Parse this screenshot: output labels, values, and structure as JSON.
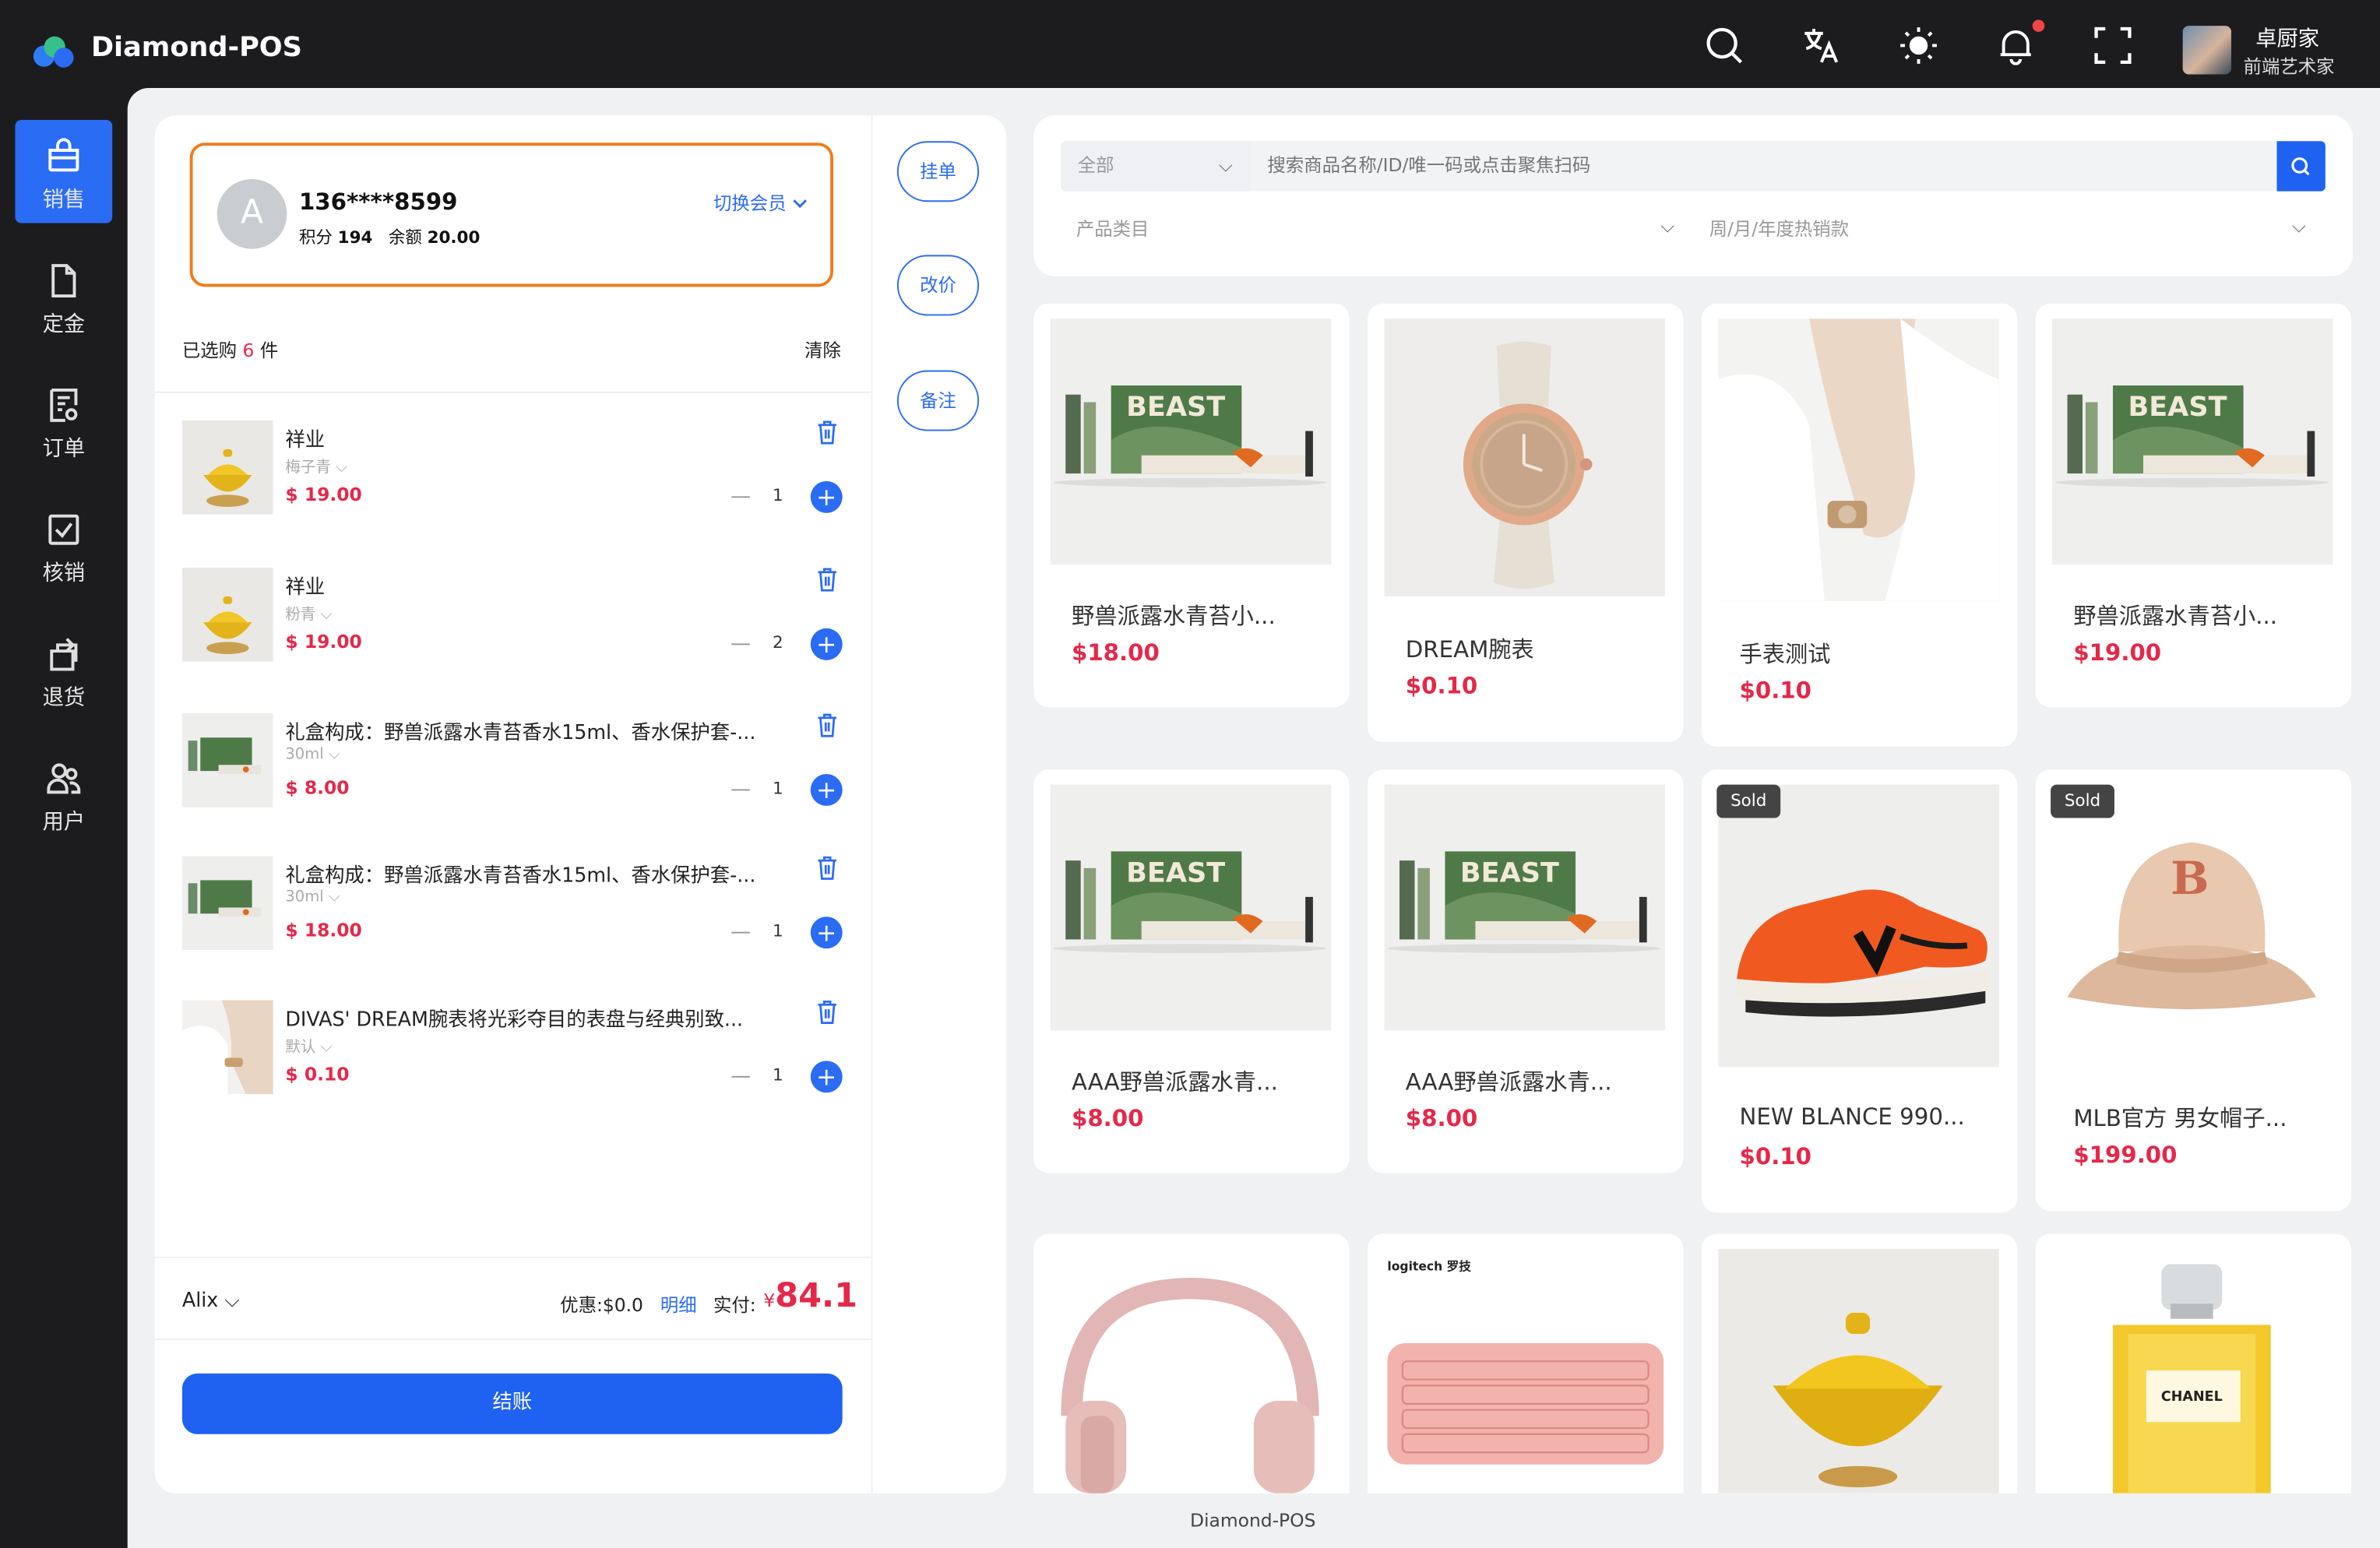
{
  "app": {
    "title": "Diamond-POS",
    "footer": "Diamond-POS"
  },
  "user": {
    "name": "卓厨家",
    "role": "前端艺术家"
  },
  "topbar_icons": [
    "search-icon",
    "translate-icon",
    "theme-sun-icon",
    "bell-icon",
    "fullscreen-icon"
  ],
  "sidebar": {
    "items": [
      {
        "label": "销售",
        "icon": "shop-bag-icon",
        "active": true
      },
      {
        "label": "定金",
        "icon": "document-icon"
      },
      {
        "label": "订单",
        "icon": "order-icon"
      },
      {
        "label": "核销",
        "icon": "checkbox-icon"
      },
      {
        "label": "退货",
        "icon": "return-icon"
      },
      {
        "label": "用户",
        "icon": "users-icon"
      }
    ]
  },
  "member": {
    "avatar_letter": "A",
    "phone": "136****8599",
    "points_label": "积分",
    "points": "194",
    "balance_label": "余额",
    "balance": "20.00",
    "switch_label": "切换会员"
  },
  "cart": {
    "selected_prefix": "已选购",
    "selected_count": "6",
    "selected_suffix": "件",
    "clear_label": "清除",
    "items": [
      {
        "name": "祥业",
        "spec": "梅子青",
        "price": "$ 19.00",
        "qty": "1",
        "thumb": "teacup"
      },
      {
        "name": "祥业",
        "spec": "粉青",
        "price": "$ 19.00",
        "qty": "2",
        "thumb": "teacup"
      },
      {
        "name": "礼盒构成：野兽派露水青苔香水15ml、香水保护套-...",
        "spec": "30ml",
        "price": "$ 8.00",
        "qty": "1",
        "thumb": "beast"
      },
      {
        "name": "礼盒构成：野兽派露水青苔香水15ml、香水保护套-...",
        "spec": "30ml",
        "price": "$ 18.00",
        "qty": "1",
        "thumb": "beast"
      },
      {
        "name": "DIVAS' DREAM腕表将光彩夺目的表盘与经典别致...",
        "spec": "默认",
        "price": "$ 0.10",
        "qty": "1",
        "thumb": "wrist"
      }
    ],
    "staff": "Alix",
    "discount_label": "优惠:$0.0",
    "detail_label": "明细",
    "paid_label": "实付:",
    "currency": "¥",
    "paid_amount": "84.1",
    "checkout_label": "结账"
  },
  "actions": {
    "hold": "挂单",
    "reprice": "改价",
    "note": "备注"
  },
  "search": {
    "category": "全部",
    "placeholder": "搜索商品名称/ID/唯一码或点击聚焦扫码",
    "filter_category": "产品类目",
    "filter_hot": "周/月/年度热销款"
  },
  "products": [
    {
      "name": "野兽派露水青苔小...",
      "price": "$18.00",
      "image": "beast"
    },
    {
      "name": "DREAM腕表",
      "price": "$0.10",
      "image": "watch"
    },
    {
      "name": "手表测试",
      "price": "$0.10",
      "image": "wrist"
    },
    {
      "name": "野兽派露水青苔小...",
      "price": "$19.00",
      "image": "beast"
    },
    {
      "name": "AAA野兽派露水青...",
      "price": "$8.00",
      "image": "beast"
    },
    {
      "name": "AAA野兽派露水青...",
      "price": "$8.00",
      "image": "beast"
    },
    {
      "name": "NEW BLANCE 990...",
      "price": "$0.10",
      "image": "sneaker",
      "badge": "Sold"
    },
    {
      "name": "MLB官方 男女帽子...",
      "price": "$199.00",
      "image": "hat",
      "badge": "Sold"
    },
    {
      "name": "",
      "price": "",
      "image": "headphones"
    },
    {
      "name": "",
      "price": "",
      "image": "keyboard",
      "brand": "logitech 罗技"
    },
    {
      "name": "",
      "price": "",
      "image": "teacup"
    },
    {
      "name": "",
      "price": "",
      "image": "perfume",
      "brand": "CHANEL"
    }
  ],
  "colors": {
    "accent": "#2b6cf5",
    "price": "#e5284a",
    "highlight_border": "#f07d1c",
    "dark": "#1c1c1e"
  }
}
